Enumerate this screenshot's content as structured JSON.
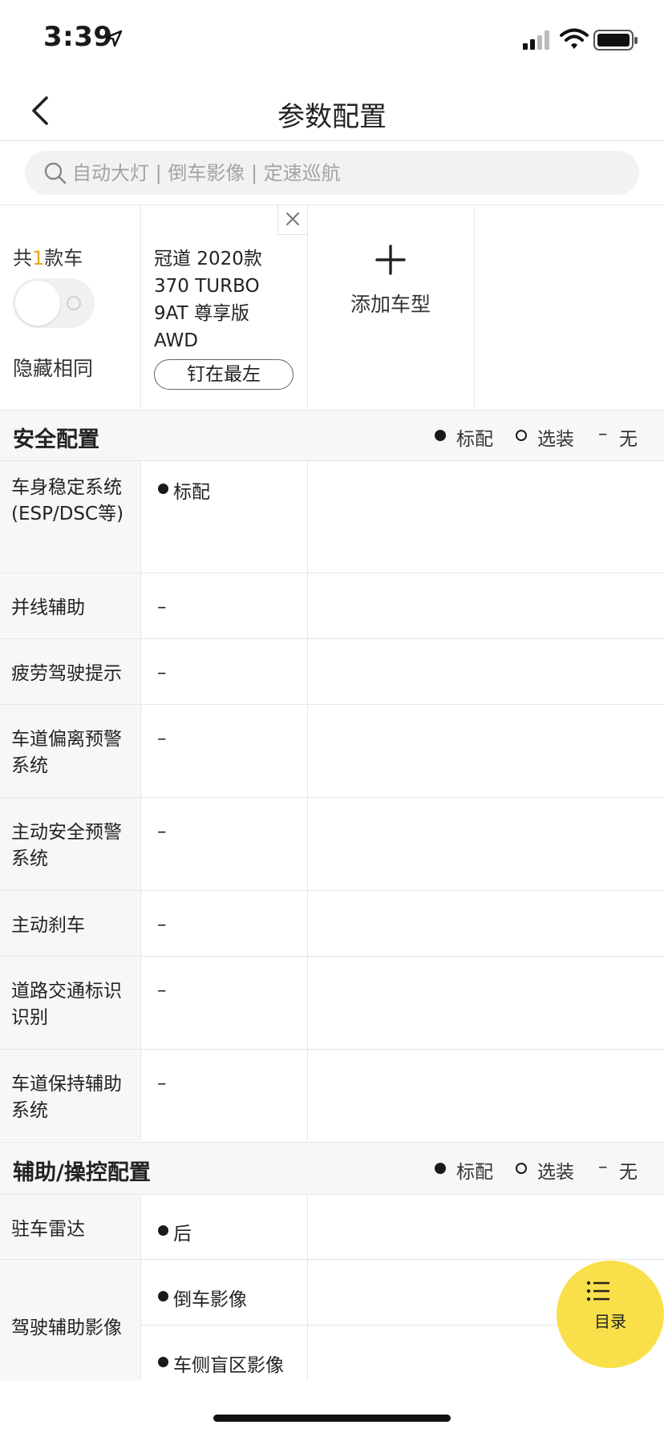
{
  "status_bar": {
    "time": "3:39"
  },
  "nav": {
    "title": "参数配置"
  },
  "search": {
    "placeholder": "自动大灯 | 倒车影像 | 定速巡航"
  },
  "car_header": {
    "count_prefix": "共",
    "count": "1",
    "count_suffix": "款车",
    "hide_same_label": "隐藏相同",
    "hide_same_on": false,
    "cars": [
      {
        "name": "冠道 2020款 370 TURBO 9AT 尊享版 AWD",
        "pin_label": "钉在最左"
      }
    ],
    "add_label": "添加车型"
  },
  "legend": {
    "standard": "标配",
    "optional": "选装",
    "none": "无"
  },
  "sections": [
    {
      "title": "安全配置",
      "rows": [
        {
          "label": "车身稳定系统 (ESP/DSC等)",
          "value": "标配",
          "marker": "dot"
        },
        {
          "label": "并线辅助",
          "value": "–"
        },
        {
          "label": "疲劳驾驶提示",
          "value": "–"
        },
        {
          "label": "车道偏离预警系统",
          "value": "–"
        },
        {
          "label": "主动安全预警系统",
          "value": "–"
        },
        {
          "label": "主动刹车",
          "value": "–"
        },
        {
          "label": "道路交通标识识别",
          "value": "–"
        },
        {
          "label": "车道保持辅助系统",
          "value": "–"
        }
      ]
    },
    {
      "title": "辅助/操控配置",
      "rows": [
        {
          "label": "驻车雷达",
          "value": "后",
          "marker": "dot"
        },
        {
          "label": "驾驶辅助影像",
          "values": [
            "倒车影像",
            "车侧盲区影像"
          ],
          "marker": "dot"
        }
      ]
    }
  ],
  "fab": {
    "label": "目录"
  },
  "colors": {
    "accent": "#f9e04b",
    "highlight": "#e6a817",
    "label_bg": "#f7f7f7"
  }
}
